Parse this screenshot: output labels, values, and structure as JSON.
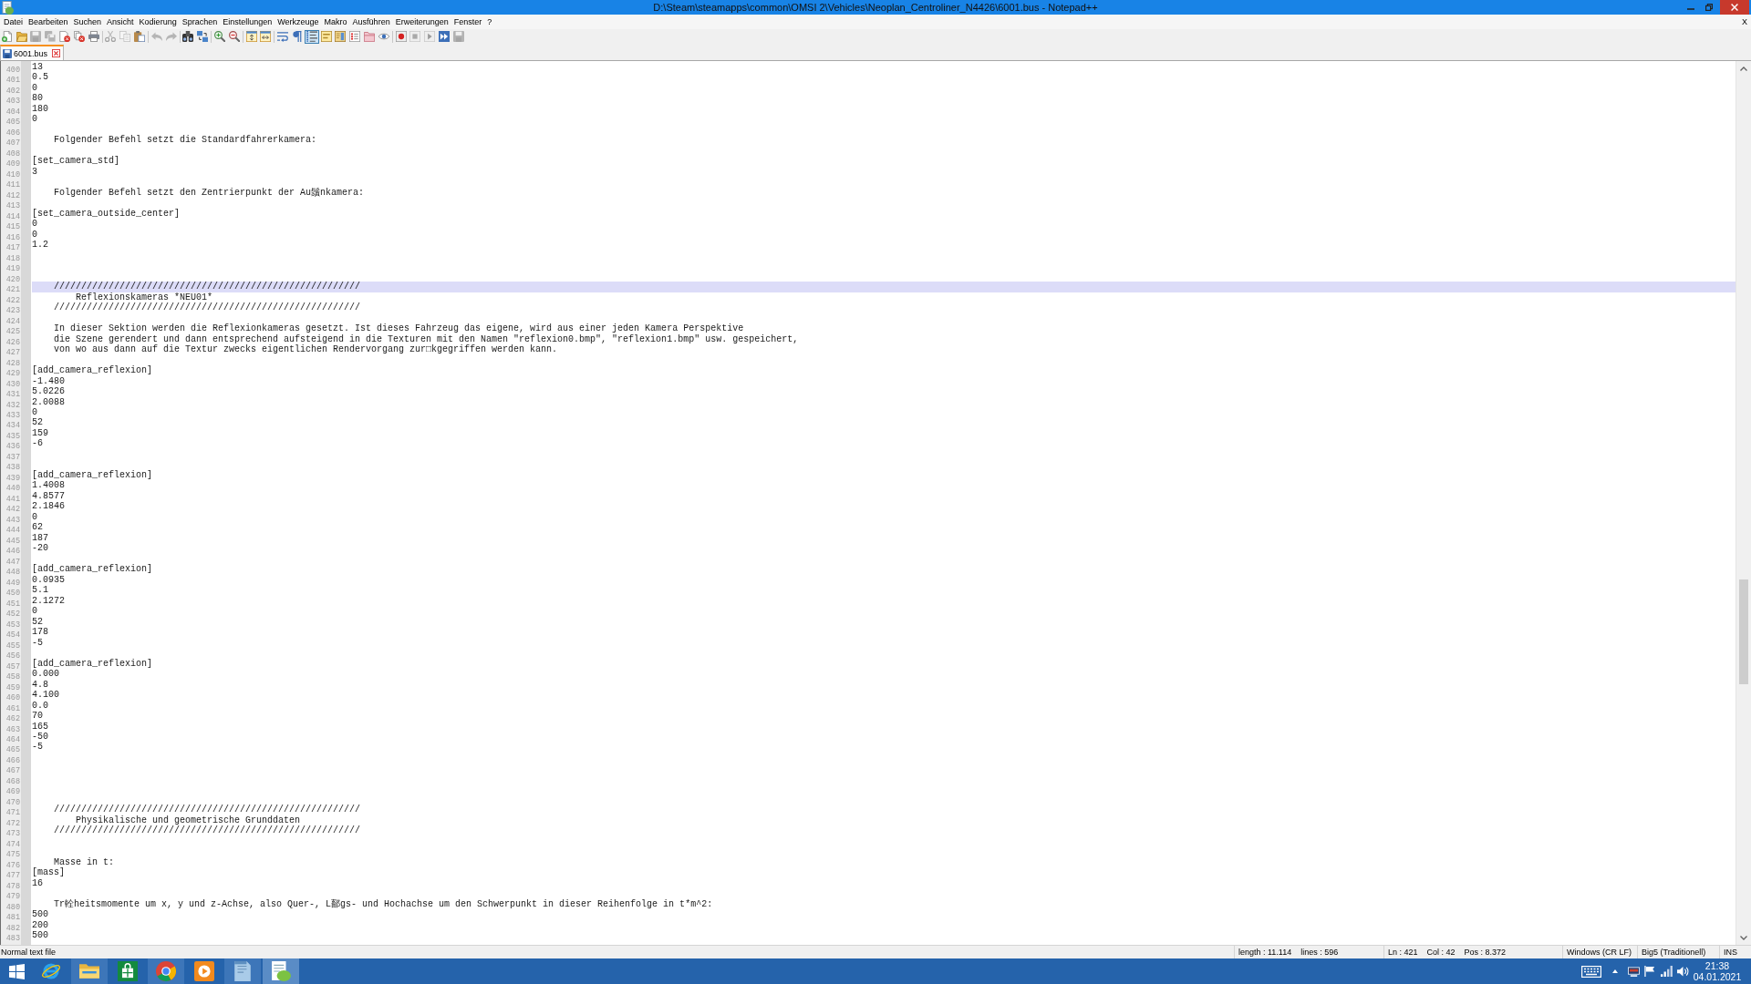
{
  "window": {
    "title": "D:\\Steam\\steamapps\\common\\OMSI 2\\Vehicles\\Neoplan_Centroliner_N4426\\6001.bus - Notepad++"
  },
  "menu_bar": {
    "items": [
      "Datei",
      "Bearbeiten",
      "Suchen",
      "Ansicht",
      "Kodierung",
      "Sprachen",
      "Einstellungen",
      "Werkzeuge",
      "Makro",
      "Ausführen",
      "Erweiterungen",
      "Fenster",
      "?"
    ],
    "close_document": "X"
  },
  "toolbar": {
    "groups": [
      [
        {
          "kind": "new",
          "disabled": false,
          "pressed": false
        },
        {
          "kind": "open",
          "disabled": false,
          "pressed": false
        },
        {
          "kind": "save",
          "disabled": true,
          "pressed": false
        },
        {
          "kind": "saveall",
          "disabled": true,
          "pressed": false
        },
        {
          "kind": "close",
          "disabled": false,
          "pressed": false
        },
        {
          "kind": "closeall",
          "disabled": false,
          "pressed": false
        },
        {
          "kind": "print",
          "disabled": false,
          "pressed": false
        }
      ],
      [
        {
          "kind": "cut",
          "disabled": true,
          "pressed": false
        },
        {
          "kind": "copy",
          "disabled": true,
          "pressed": false
        },
        {
          "kind": "paste",
          "disabled": false,
          "pressed": false
        }
      ],
      [
        {
          "kind": "undo",
          "disabled": true,
          "pressed": false
        },
        {
          "kind": "redo",
          "disabled": true,
          "pressed": false
        }
      ],
      [
        {
          "kind": "find",
          "disabled": false,
          "pressed": false
        },
        {
          "kind": "replace",
          "disabled": false,
          "pressed": false
        }
      ],
      [
        {
          "kind": "zoomin",
          "disabled": false,
          "pressed": false
        },
        {
          "kind": "zoomout",
          "disabled": false,
          "pressed": false
        }
      ],
      [
        {
          "kind": "syncv",
          "disabled": false,
          "pressed": false
        },
        {
          "kind": "synch",
          "disabled": false,
          "pressed": false
        }
      ],
      [
        {
          "kind": "wrap",
          "disabled": false,
          "pressed": false
        },
        {
          "kind": "allchars",
          "disabled": false,
          "pressed": false
        },
        {
          "kind": "indentguide",
          "disabled": false,
          "pressed": true
        },
        {
          "kind": "udl",
          "disabled": false,
          "pressed": false
        },
        {
          "kind": "docmap",
          "disabled": false,
          "pressed": false
        },
        {
          "kind": "funclist",
          "disabled": false,
          "pressed": false
        },
        {
          "kind": "workspace",
          "disabled": false,
          "pressed": false
        },
        {
          "kind": "monitor",
          "disabled": false,
          "pressed": false
        }
      ],
      [
        {
          "kind": "record",
          "disabled": false,
          "pressed": false
        },
        {
          "kind": "stop",
          "disabled": true,
          "pressed": false
        },
        {
          "kind": "play",
          "disabled": true,
          "pressed": false
        },
        {
          "kind": "playmulti",
          "disabled": false,
          "pressed": false
        },
        {
          "kind": "savemacro",
          "disabled": true,
          "pressed": false
        }
      ]
    ]
  },
  "tabs": [
    {
      "label": "6001.bus",
      "selected": true,
      "modified": false
    }
  ],
  "editor": {
    "lines": [
      {
        "number": "400",
        "text": "13",
        "current": false
      },
      {
        "number": "401",
        "text": "0.5",
        "current": false
      },
      {
        "number": "402",
        "text": "0",
        "current": false
      },
      {
        "number": "403",
        "text": "80",
        "current": false
      },
      {
        "number": "404",
        "text": "180",
        "current": false
      },
      {
        "number": "405",
        "text": "0",
        "current": false
      },
      {
        "number": "406",
        "current": false
      },
      {
        "number": "407",
        "text": "    Folgender Befehl setzt die Standardfahrerkamera:",
        "current": false
      },
      {
        "number": "408",
        "current": false
      },
      {
        "number": "409",
        "text": "[set_camera_std]",
        "current": false
      },
      {
        "number": "410",
        "text": "3",
        "current": false
      },
      {
        "number": "411",
        "current": false
      },
      {
        "number": "412",
        "text": "    Folgender Befehl setzt den Zentrierpunkt der Au鬚nkamera:",
        "current": false
      },
      {
        "number": "413",
        "current": false
      },
      {
        "number": "414",
        "text": "[set_camera_outside_center]",
        "current": false
      },
      {
        "number": "415",
        "text": "0",
        "current": false
      },
      {
        "number": "416",
        "text": "0",
        "current": false
      },
      {
        "number": "417",
        "text": "1.2",
        "current": false
      },
      {
        "number": "418",
        "current": false
      },
      {
        "number": "419",
        "current": false
      },
      {
        "number": "420",
        "current": false
      },
      {
        "number": "421",
        "text": "    ////////////////////////////////////////////////////////",
        "current": true
      },
      {
        "number": "422",
        "text": "        Reflexionskameras *NEU01*",
        "current": false
      },
      {
        "number": "423",
        "text": "    ////////////////////////////////////////////////////////",
        "current": false
      },
      {
        "number": "424",
        "current": false
      },
      {
        "number": "425",
        "text": "    In dieser Sektion werden die Reflexionkameras gesetzt. Ist dieses Fahrzeug das eigene, wird aus einer jeden Kamera Perspektive",
        "current": false
      },
      {
        "number": "426",
        "text": "    die Szene gerendert und dann entsprechend aufsteigend in die Texturen mit den Namen \"reflexion0.bmp\", \"reflexion1.bmp\" usw. gespeichert,",
        "current": false
      },
      {
        "number": "427",
        "text": "    von wo aus dann auf die Textur zwecks eigentlichen Rendervorgang zur□kgegriffen werden kann.",
        "current": false
      },
      {
        "number": "428",
        "current": false
      },
      {
        "number": "429",
        "text": "[add_camera_reflexion]",
        "current": false
      },
      {
        "number": "430",
        "text": "-1.480",
        "current": false
      },
      {
        "number": "431",
        "text": "5.0226",
        "current": false
      },
      {
        "number": "432",
        "text": "2.0088",
        "current": false
      },
      {
        "number": "433",
        "text": "0",
        "current": false
      },
      {
        "number": "434",
        "text": "52",
        "current": false
      },
      {
        "number": "435",
        "text": "159",
        "current": false
      },
      {
        "number": "436",
        "text": "-6",
        "current": false
      },
      {
        "number": "437",
        "current": false
      },
      {
        "number": "438",
        "current": false
      },
      {
        "number": "439",
        "text": "[add_camera_reflexion]",
        "current": false
      },
      {
        "number": "440",
        "text": "1.4008",
        "current": false
      },
      {
        "number": "441",
        "text": "4.8577",
        "current": false
      },
      {
        "number": "442",
        "text": "2.1846",
        "current": false
      },
      {
        "number": "443",
        "text": "0",
        "current": false
      },
      {
        "number": "444",
        "text": "62",
        "current": false
      },
      {
        "number": "445",
        "text": "187",
        "current": false
      },
      {
        "number": "446",
        "text": "-20",
        "current": false
      },
      {
        "number": "447",
        "current": false
      },
      {
        "number": "448",
        "text": "[add_camera_reflexion]",
        "current": false
      },
      {
        "number": "449",
        "text": "0.0935",
        "current": false
      },
      {
        "number": "450",
        "text": "5.1",
        "current": false
      },
      {
        "number": "451",
        "text": "2.1272",
        "current": false
      },
      {
        "number": "452",
        "text": "0",
        "current": false
      },
      {
        "number": "453",
        "text": "52",
        "current": false
      },
      {
        "number": "454",
        "text": "178",
        "current": false
      },
      {
        "number": "455",
        "text": "-5",
        "current": false
      },
      {
        "number": "456",
        "current": false
      },
      {
        "number": "457",
        "text": "[add_camera_reflexion]",
        "current": false
      },
      {
        "number": "458",
        "text": "0.000",
        "current": false
      },
      {
        "number": "459",
        "text": "4.8",
        "current": false
      },
      {
        "number": "460",
        "text": "4.100",
        "current": false
      },
      {
        "number": "461",
        "text": "0.0",
        "current": false
      },
      {
        "number": "462",
        "text": "70",
        "current": false
      },
      {
        "number": "463",
        "text": "165",
        "current": false
      },
      {
        "number": "464",
        "text": "-50",
        "current": false
      },
      {
        "number": "465",
        "text": "-5",
        "current": false
      },
      {
        "number": "466",
        "current": false
      },
      {
        "number": "467",
        "current": false
      },
      {
        "number": "468",
        "current": false
      },
      {
        "number": "469",
        "current": false
      },
      {
        "number": "470",
        "current": false
      },
      {
        "number": "471",
        "text": "    ////////////////////////////////////////////////////////",
        "current": false
      },
      {
        "number": "472",
        "text": "        Physikalische und geometrische Grunddaten",
        "current": false
      },
      {
        "number": "473",
        "text": "    ////////////////////////////////////////////////////////",
        "current": false
      },
      {
        "number": "474",
        "current": false
      },
      {
        "number": "475",
        "current": false
      },
      {
        "number": "476",
        "text": "    Masse in t:",
        "current": false
      },
      {
        "number": "477",
        "text": "[mass]",
        "current": false
      },
      {
        "number": "478",
        "text": "16",
        "current": false
      },
      {
        "number": "479",
        "current": false
      },
      {
        "number": "480",
        "text": "    Tr輇heitsmomente um x, y und z-Achse, also Quer-, L鄐gs- und Hochachse um den Schwerpunkt in dieser Reihenfolge in t*m^2:",
        "current": false
      },
      {
        "number": "481",
        "text": "500",
        "current": false
      },
      {
        "number": "482",
        "text": "200",
        "current": false
      },
      {
        "number": "483",
        "text": "500",
        "current": false
      }
    ]
  },
  "status_bar": {
    "file_type": "Normal text file",
    "length": "length : 11.114",
    "lines": "lines : 596",
    "line": "Ln : 421",
    "column": "Col : 42",
    "position": "Pos : 8.372",
    "line_ending": "Windows (CR LF)",
    "encoding": "Big5 (Traditionell)",
    "mode": "INS"
  },
  "taskbar": {
    "apps": [
      {
        "kind": "browser",
        "running": false,
        "active": false
      },
      {
        "kind": "files",
        "running": true,
        "active": false
      },
      {
        "kind": "store",
        "running": false,
        "active": false
      },
      {
        "kind": "webbrowser",
        "running": true,
        "active": false
      },
      {
        "kind": "media",
        "running": false,
        "active": false
      },
      {
        "kind": "notes",
        "running": true,
        "active": false
      },
      {
        "kind": "editor",
        "running": true,
        "active": true
      }
    ],
    "clock": {
      "time": "21:38",
      "date": "04.01.2021"
    }
  }
}
